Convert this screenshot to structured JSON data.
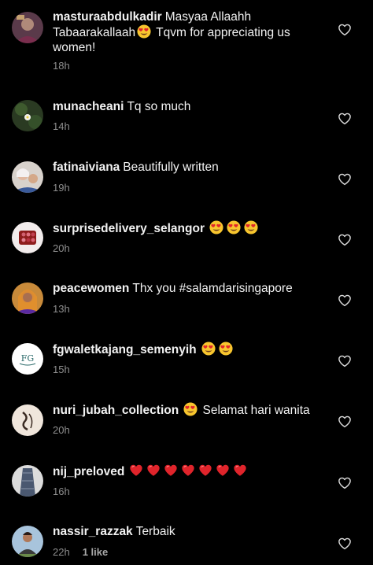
{
  "comments": [
    {
      "username": "masturaabdulkadir",
      "text_before": "Masyaa Allaahh Tabaarakallaah",
      "emoji": [
        "heart-eyes"
      ],
      "text_after": "Tqvm for appreciating us women!",
      "time": "18h"
    },
    {
      "username": "munacheani",
      "text_before": "Tq so much",
      "emoji": [],
      "text_after": "",
      "time": "14h"
    },
    {
      "username": "fatinaiviana",
      "text_before": "Beautifully written",
      "emoji": [],
      "text_after": "",
      "time": "19h"
    },
    {
      "username": "surprisedelivery_selangor",
      "text_before": "",
      "emoji": [
        "heart-eyes",
        "heart-eyes",
        "heart-eyes"
      ],
      "text_after": "",
      "time": "20h"
    },
    {
      "username": "peacewomen",
      "text_before": "Thx you #salamdarisingapore",
      "emoji": [],
      "text_after": "",
      "time": "13h"
    },
    {
      "username": "fgwaletkajang_semenyih",
      "text_before": "",
      "emoji": [
        "heart-eyes",
        "heart-eyes"
      ],
      "text_after": "",
      "time": "15h"
    },
    {
      "username": "nuri_jubah_collection",
      "text_before": "",
      "emoji": [
        "heart-eyes"
      ],
      "text_after": "Selamat hari wanita",
      "time": "20h"
    },
    {
      "username": "nij_preloved",
      "text_before": "",
      "emoji": [
        "red-heart",
        "red-heart",
        "red-heart",
        "red-heart",
        "red-heart",
        "red-heart",
        "red-heart"
      ],
      "text_after": "",
      "time": "16h"
    },
    {
      "username": "nassir_razzak",
      "text_before": "Terbaik",
      "emoji": [],
      "text_after": "",
      "time": "22h",
      "likes": "1 like"
    }
  ],
  "colors": {
    "background": "#000000",
    "text": "#f2f2f2",
    "meta": "#8e8e8e",
    "heart_outline": "#d8d8d8",
    "emoji_red": "#e0242b"
  },
  "icons": {
    "like_button": "heart-outline-icon"
  }
}
